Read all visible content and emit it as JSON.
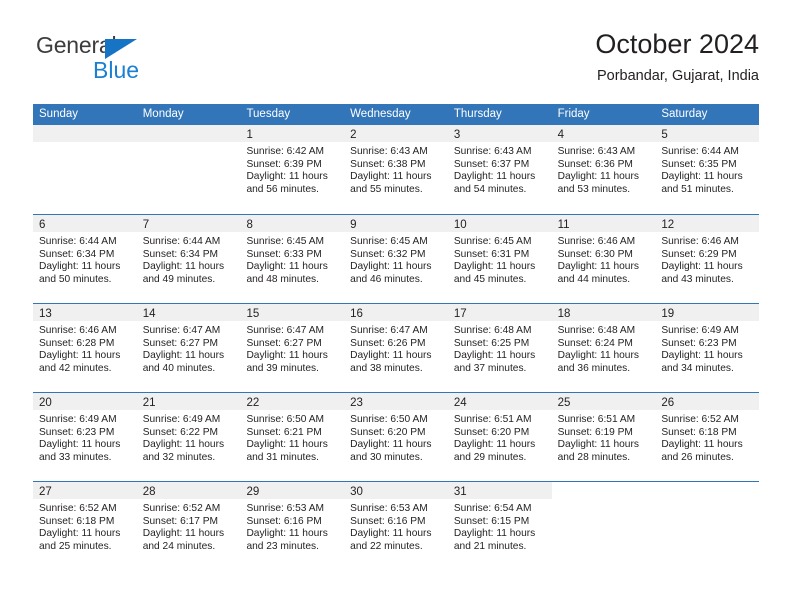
{
  "brand": {
    "line1": "General",
    "line2": "Blue",
    "triangle_icon": "blue-triangle-logo-mark",
    "color_general": "#3c3c3c",
    "color_blue": "#1b80d4"
  },
  "header": {
    "title": "October 2024",
    "subtitle": "Porbandar, Gujarat, India"
  },
  "theme": {
    "header_bg": "#3275b9",
    "header_text": "#ffffff",
    "daynum_band_bg": "#f0f0f0",
    "row_divider": "#3275b9",
    "text": "#231f20"
  },
  "weekdays": [
    "Sunday",
    "Monday",
    "Tuesday",
    "Wednesday",
    "Thursday",
    "Friday",
    "Saturday"
  ],
  "labels": {
    "sunrise_prefix": "Sunrise:",
    "sunset_prefix": "Sunset:",
    "daylight_prefix": "Daylight:"
  },
  "weeks": [
    [
      {
        "day": "",
        "empty": true
      },
      {
        "day": "",
        "empty": true
      },
      {
        "day": "1",
        "sunrise": "Sunrise: 6:42 AM",
        "sunset": "Sunset: 6:39 PM",
        "daylight_line1": "Daylight: 11 hours",
        "daylight_line2": "and 56 minutes."
      },
      {
        "day": "2",
        "sunrise": "Sunrise: 6:43 AM",
        "sunset": "Sunset: 6:38 PM",
        "daylight_line1": "Daylight: 11 hours",
        "daylight_line2": "and 55 minutes."
      },
      {
        "day": "3",
        "sunrise": "Sunrise: 6:43 AM",
        "sunset": "Sunset: 6:37 PM",
        "daylight_line1": "Daylight: 11 hours",
        "daylight_line2": "and 54 minutes."
      },
      {
        "day": "4",
        "sunrise": "Sunrise: 6:43 AM",
        "sunset": "Sunset: 6:36 PM",
        "daylight_line1": "Daylight: 11 hours",
        "daylight_line2": "and 53 minutes."
      },
      {
        "day": "5",
        "sunrise": "Sunrise: 6:44 AM",
        "sunset": "Sunset: 6:35 PM",
        "daylight_line1": "Daylight: 11 hours",
        "daylight_line2": "and 51 minutes."
      }
    ],
    [
      {
        "day": "6",
        "sunrise": "Sunrise: 6:44 AM",
        "sunset": "Sunset: 6:34 PM",
        "daylight_line1": "Daylight: 11 hours",
        "daylight_line2": "and 50 minutes."
      },
      {
        "day": "7",
        "sunrise": "Sunrise: 6:44 AM",
        "sunset": "Sunset: 6:34 PM",
        "daylight_line1": "Daylight: 11 hours",
        "daylight_line2": "and 49 minutes."
      },
      {
        "day": "8",
        "sunrise": "Sunrise: 6:45 AM",
        "sunset": "Sunset: 6:33 PM",
        "daylight_line1": "Daylight: 11 hours",
        "daylight_line2": "and 48 minutes."
      },
      {
        "day": "9",
        "sunrise": "Sunrise: 6:45 AM",
        "sunset": "Sunset: 6:32 PM",
        "daylight_line1": "Daylight: 11 hours",
        "daylight_line2": "and 46 minutes."
      },
      {
        "day": "10",
        "sunrise": "Sunrise: 6:45 AM",
        "sunset": "Sunset: 6:31 PM",
        "daylight_line1": "Daylight: 11 hours",
        "daylight_line2": "and 45 minutes."
      },
      {
        "day": "11",
        "sunrise": "Sunrise: 6:46 AM",
        "sunset": "Sunset: 6:30 PM",
        "daylight_line1": "Daylight: 11 hours",
        "daylight_line2": "and 44 minutes."
      },
      {
        "day": "12",
        "sunrise": "Sunrise: 6:46 AM",
        "sunset": "Sunset: 6:29 PM",
        "daylight_line1": "Daylight: 11 hours",
        "daylight_line2": "and 43 minutes."
      }
    ],
    [
      {
        "day": "13",
        "sunrise": "Sunrise: 6:46 AM",
        "sunset": "Sunset: 6:28 PM",
        "daylight_line1": "Daylight: 11 hours",
        "daylight_line2": "and 42 minutes."
      },
      {
        "day": "14",
        "sunrise": "Sunrise: 6:47 AM",
        "sunset": "Sunset: 6:27 PM",
        "daylight_line1": "Daylight: 11 hours",
        "daylight_line2": "and 40 minutes."
      },
      {
        "day": "15",
        "sunrise": "Sunrise: 6:47 AM",
        "sunset": "Sunset: 6:27 PM",
        "daylight_line1": "Daylight: 11 hours",
        "daylight_line2": "and 39 minutes."
      },
      {
        "day": "16",
        "sunrise": "Sunrise: 6:47 AM",
        "sunset": "Sunset: 6:26 PM",
        "daylight_line1": "Daylight: 11 hours",
        "daylight_line2": "and 38 minutes."
      },
      {
        "day": "17",
        "sunrise": "Sunrise: 6:48 AM",
        "sunset": "Sunset: 6:25 PM",
        "daylight_line1": "Daylight: 11 hours",
        "daylight_line2": "and 37 minutes."
      },
      {
        "day": "18",
        "sunrise": "Sunrise: 6:48 AM",
        "sunset": "Sunset: 6:24 PM",
        "daylight_line1": "Daylight: 11 hours",
        "daylight_line2": "and 36 minutes."
      },
      {
        "day": "19",
        "sunrise": "Sunrise: 6:49 AM",
        "sunset": "Sunset: 6:23 PM",
        "daylight_line1": "Daylight: 11 hours",
        "daylight_line2": "and 34 minutes."
      }
    ],
    [
      {
        "day": "20",
        "sunrise": "Sunrise: 6:49 AM",
        "sunset": "Sunset: 6:23 PM",
        "daylight_line1": "Daylight: 11 hours",
        "daylight_line2": "and 33 minutes."
      },
      {
        "day": "21",
        "sunrise": "Sunrise: 6:49 AM",
        "sunset": "Sunset: 6:22 PM",
        "daylight_line1": "Daylight: 11 hours",
        "daylight_line2": "and 32 minutes."
      },
      {
        "day": "22",
        "sunrise": "Sunrise: 6:50 AM",
        "sunset": "Sunset: 6:21 PM",
        "daylight_line1": "Daylight: 11 hours",
        "daylight_line2": "and 31 minutes."
      },
      {
        "day": "23",
        "sunrise": "Sunrise: 6:50 AM",
        "sunset": "Sunset: 6:20 PM",
        "daylight_line1": "Daylight: 11 hours",
        "daylight_line2": "and 30 minutes."
      },
      {
        "day": "24",
        "sunrise": "Sunrise: 6:51 AM",
        "sunset": "Sunset: 6:20 PM",
        "daylight_line1": "Daylight: 11 hours",
        "daylight_line2": "and 29 minutes."
      },
      {
        "day": "25",
        "sunrise": "Sunrise: 6:51 AM",
        "sunset": "Sunset: 6:19 PM",
        "daylight_line1": "Daylight: 11 hours",
        "daylight_line2": "and 28 minutes."
      },
      {
        "day": "26",
        "sunrise": "Sunrise: 6:52 AM",
        "sunset": "Sunset: 6:18 PM",
        "daylight_line1": "Daylight: 11 hours",
        "daylight_line2": "and 26 minutes."
      }
    ],
    [
      {
        "day": "27",
        "sunrise": "Sunrise: 6:52 AM",
        "sunset": "Sunset: 6:18 PM",
        "daylight_line1": "Daylight: 11 hours",
        "daylight_line2": "and 25 minutes."
      },
      {
        "day": "28",
        "sunrise": "Sunrise: 6:52 AM",
        "sunset": "Sunset: 6:17 PM",
        "daylight_line1": "Daylight: 11 hours",
        "daylight_line2": "and 24 minutes."
      },
      {
        "day": "29",
        "sunrise": "Sunrise: 6:53 AM",
        "sunset": "Sunset: 6:16 PM",
        "daylight_line1": "Daylight: 11 hours",
        "daylight_line2": "and 23 minutes."
      },
      {
        "day": "30",
        "sunrise": "Sunrise: 6:53 AM",
        "sunset": "Sunset: 6:16 PM",
        "daylight_line1": "Daylight: 11 hours",
        "daylight_line2": "and 22 minutes."
      },
      {
        "day": "31",
        "sunrise": "Sunrise: 6:54 AM",
        "sunset": "Sunset: 6:15 PM",
        "daylight_line1": "Daylight: 11 hours",
        "daylight_line2": "and 21 minutes."
      },
      {
        "day": "",
        "blank": true
      },
      {
        "day": "",
        "blank": true
      }
    ]
  ]
}
